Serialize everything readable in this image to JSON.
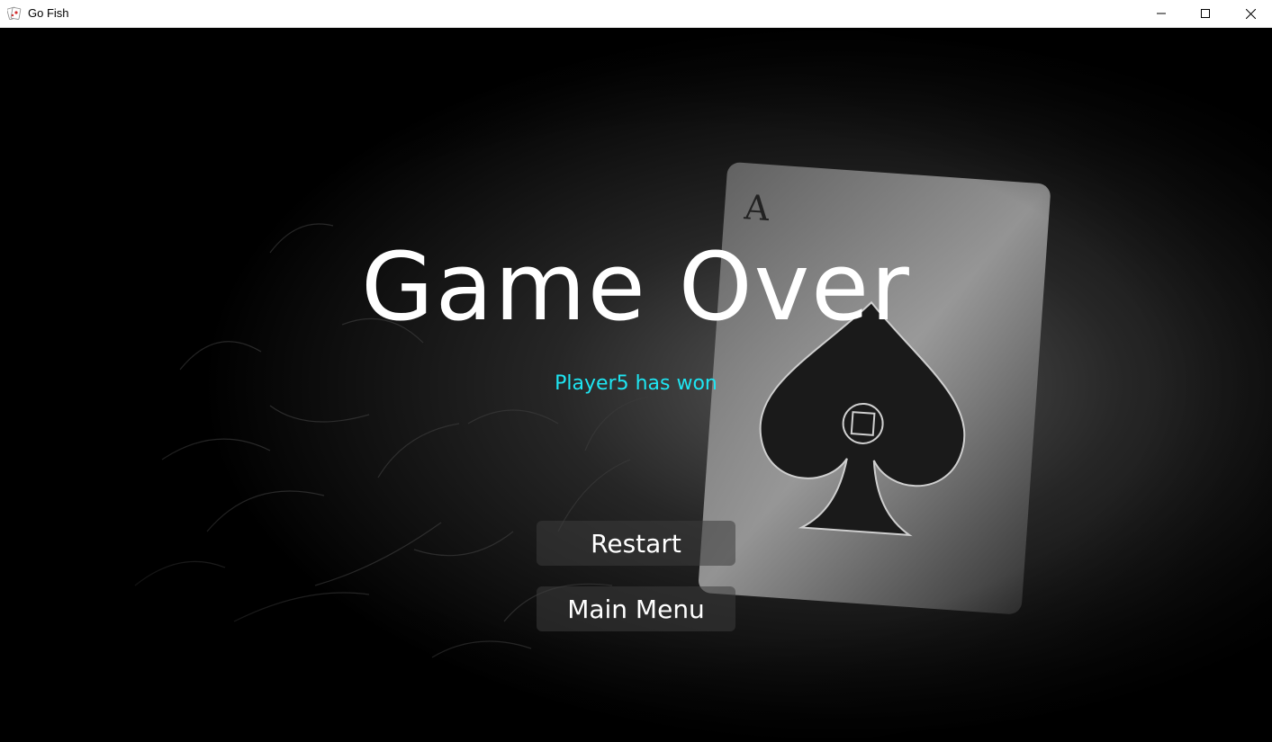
{
  "window": {
    "title": "Go Fish",
    "app_icon": "playing-cards-icon",
    "controls": [
      "minimize-icon",
      "maximize-icon",
      "close-icon"
    ]
  },
  "game_over": {
    "title": "Game Over",
    "winner_text": "Player5 has won",
    "winner_color": "#1ee5f2",
    "buttons": {
      "restart": "Restart",
      "main_menu": "Main Menu"
    }
  },
  "background": {
    "description_icon": "ace-of-spades-card-icon",
    "card_rank": "A"
  }
}
